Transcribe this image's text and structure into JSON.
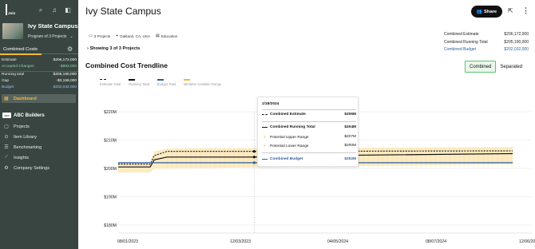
{
  "brand": {
    "logo_text": "Join"
  },
  "sidebar": {
    "project_name": "Ivy State Campus",
    "project_switcher": "Program of 3 Projects",
    "tab_label": "Combined Costs",
    "metrics": [
      {
        "label": "Estimate",
        "value": "$206,172,000",
        "style": "normal"
      },
      {
        "label": "Accepted Changes",
        "value": "-$982,000",
        "style": "green"
      },
      {
        "label": "Running total",
        "value": "$205,190,000",
        "style": "normal"
      },
      {
        "label": "Gap",
        "value": "-$3,158,000",
        "style": "normal"
      },
      {
        "label": "Budget",
        "value": "$202,032,000",
        "style": "blue"
      }
    ],
    "dashboard_label": "Dashboard",
    "company_badge": "ABC",
    "company_name": "ABC Builders",
    "nav": [
      {
        "label": "Projects",
        "icon": "projects-icon"
      },
      {
        "label": "Item Library",
        "icon": "item-library-icon"
      },
      {
        "label": "Benchmarking",
        "icon": "benchmarking-icon"
      },
      {
        "label": "Insights",
        "icon": "insights-icon"
      },
      {
        "label": "Company Settings",
        "icon": "settings-icon"
      }
    ]
  },
  "header": {
    "title": "Ivy State Campus",
    "share_label": "Share",
    "chips": [
      {
        "label": "3 Projects",
        "icon": "folder-icon"
      },
      {
        "label": "Oakland, CA, USA",
        "icon": "location-icon"
      },
      {
        "label": "Education",
        "icon": "building-icon"
      }
    ],
    "showing": "Showing 3 of 3 Projects"
  },
  "summary": [
    {
      "label": "Combined Estimate",
      "value": "$206,172,000",
      "style": "normal"
    },
    {
      "label": "Combined Running Total",
      "value": "$205,190,000",
      "style": "normal"
    },
    {
      "label": "Combined Budget",
      "value": "$202,032,000",
      "style": "blue"
    }
  ],
  "section_title": "Combined Cost Trendline",
  "toggle": {
    "combined": "Combined",
    "separated": "Separated",
    "active": "combined"
  },
  "legend": [
    {
      "label": "Estimate Total",
      "color": "#111111",
      "style": "dashed"
    },
    {
      "label": "Running Total",
      "color": "#111111",
      "style": "solid"
    },
    {
      "label": "Budget Total",
      "color": "#2d5c9e",
      "style": "solid"
    },
    {
      "label": "Min/Max Available Range",
      "color": "#f4b73d",
      "style": "band"
    }
  ],
  "tooltip": {
    "date": "1/18/2024",
    "rows": [
      {
        "label": "Combined Estimate",
        "value": "$206M",
        "swatch": "dashed",
        "style": "bold"
      },
      {
        "label": "Combined Running Total",
        "value": "$204M",
        "swatch": "solid",
        "style": "bold"
      },
      {
        "label": "Potential Upper Range",
        "value": "$207M",
        "swatch": "plus",
        "style": "normal"
      },
      {
        "label": "Potential Lower Range",
        "value": "$200M",
        "swatch": "plus",
        "style": "normal"
      },
      {
        "label": "Combined Budget",
        "value": "$202M",
        "swatch": "blue",
        "style": "blue"
      }
    ]
  },
  "chart_data": {
    "type": "line",
    "title": "Combined Cost Trendline",
    "yticks": [
      "$220M",
      "$210M",
      "$200M",
      "$190M",
      "$180M"
    ],
    "ytick_values": [
      220,
      210,
      200,
      190,
      180
    ],
    "ylim": [
      178,
      224
    ],
    "xticks": [
      "08/01/2023",
      "12/03/2023",
      "04/05/2024",
      "08/07/2024",
      "12/06/2024"
    ],
    "x_range": [
      "2023-08-01",
      "2024-12-06"
    ],
    "series": [
      {
        "name": "Estimate Total",
        "style": "dashed",
        "points": [
          [
            "2023-08-01",
            201.5
          ],
          [
            "2023-09-10",
            201.5
          ],
          [
            "2023-09-15",
            204.5
          ],
          [
            "2023-10-01",
            206
          ],
          [
            "2024-01-18",
            206
          ],
          [
            "2024-12-06",
            206.2
          ]
        ]
      },
      {
        "name": "Running Total",
        "style": "solid",
        "points": [
          [
            "2023-08-01",
            200.5
          ],
          [
            "2023-09-10",
            200.5
          ],
          [
            "2023-09-15",
            203
          ],
          [
            "2023-10-01",
            204
          ],
          [
            "2024-01-18",
            204
          ],
          [
            "2024-05-01",
            204.6
          ],
          [
            "2024-12-06",
            205.2
          ]
        ]
      },
      {
        "name": "Budget Total",
        "style": "solid",
        "points": [
          [
            "2023-08-01",
            202
          ],
          [
            "2024-12-06",
            202
          ]
        ]
      }
    ],
    "range_band": {
      "name": "Min/Max Available Range",
      "upper": [
        [
          "2023-08-01",
          202
        ],
        [
          "2023-09-10",
          202
        ],
        [
          "2023-09-15",
          206
        ],
        [
          "2023-10-01",
          207
        ],
        [
          "2024-12-06",
          207.5
        ]
      ],
      "lower": [
        [
          "2023-08-01",
          198.5
        ],
        [
          "2023-09-10",
          198.5
        ],
        [
          "2023-09-15",
          200
        ],
        [
          "2023-10-01",
          200
        ],
        [
          "2024-12-06",
          201.5
        ]
      ]
    },
    "hover_date": "2024-01-18"
  }
}
